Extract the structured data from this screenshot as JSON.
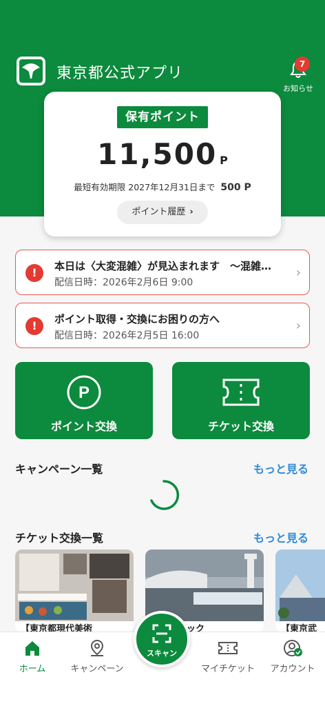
{
  "header": {
    "app_title": "東京都公式アプリ",
    "notice_label": "お知らせ",
    "notice_count": "7"
  },
  "points": {
    "tag": "保有ポイント",
    "value": "11,500",
    "unit": "P",
    "expiry_label": "最短有効期限 2027年12月31日まで",
    "expiry_points": "500 P",
    "history_label": "ポイント履歴"
  },
  "alerts": [
    {
      "title": "本日は〈大変混雑〉が見込まれます　〜混雑…",
      "date": "配信日時：2026年2月6日 9:00"
    },
    {
      "title": "ポイント取得・交換にお困りの方へ",
      "date": "配信日時：2026年2月5日 16:00"
    }
  ],
  "actions": {
    "point_exchange": "ポイント交換",
    "ticket_exchange": "チケット交換"
  },
  "campaign": {
    "title": "キャンペーン一覧",
    "more": "もっと見る"
  },
  "tickets": {
    "title": "チケット交換一覧",
    "more": "もっと見る",
    "items": [
      {
        "caption": "【東京都現代美術"
      },
      {
        "caption": "オリンピック"
      },
      {
        "caption": "【東京武"
      }
    ]
  },
  "nav": {
    "home": "ホーム",
    "campaign": "キャンペーン",
    "scan": "スキャン",
    "my_ticket": "マイチケット",
    "account": "アカウント"
  },
  "colors": {
    "brand": "#0c8a3d",
    "alert": "#e33a32",
    "link": "#2f8ad8"
  }
}
